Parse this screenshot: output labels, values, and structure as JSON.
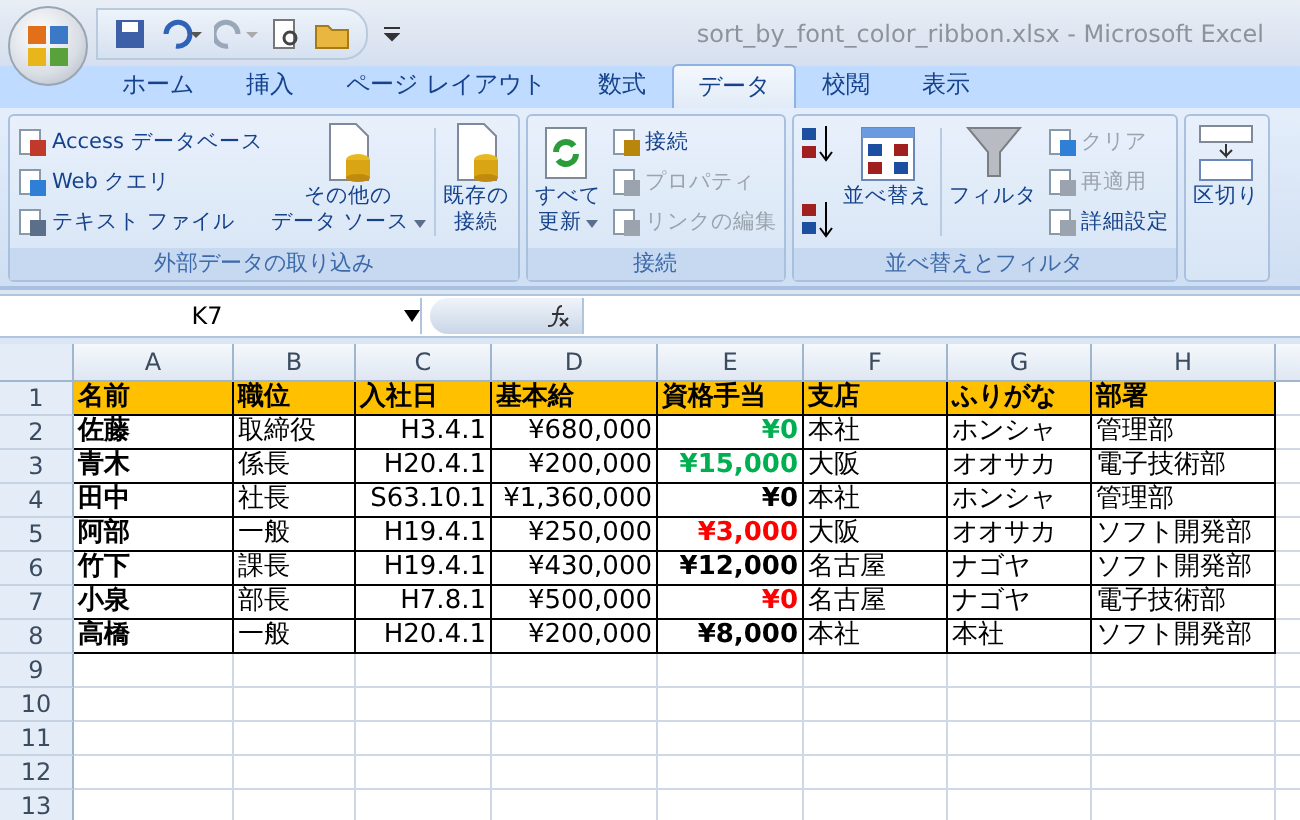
{
  "window": {
    "title": "sort_by_font_color_ribbon.xlsx - Microsoft Excel"
  },
  "tabs": [
    {
      "label": "ホーム",
      "selected": false
    },
    {
      "label": "挿入",
      "selected": false
    },
    {
      "label": "ページ レイアウト",
      "selected": false
    },
    {
      "label": "数式",
      "selected": false
    },
    {
      "label": "データ",
      "selected": true
    },
    {
      "label": "校閲",
      "selected": false
    },
    {
      "label": "表示",
      "selected": false
    }
  ],
  "ribbon_groups": [
    {
      "label": "外部データの取り込み",
      "columns": [
        {
          "kind": "stack",
          "items": [
            {
              "label": "Access データベース",
              "disabled": false
            },
            {
              "label": "Web クエリ",
              "disabled": false
            },
            {
              "label": "テキスト ファイル",
              "disabled": false
            }
          ]
        },
        {
          "kind": "large",
          "lines": [
            "その他の",
            "データ ソース"
          ],
          "dropdown": true
        },
        {
          "kind": "large",
          "lines": [
            "既存の",
            "接続"
          ]
        }
      ]
    },
    {
      "label": "接続",
      "columns": [
        {
          "kind": "large",
          "lines": [
            "すべて",
            "更新"
          ],
          "dropdown": true
        },
        {
          "kind": "stack",
          "items": [
            {
              "label": "接続",
              "disabled": false
            },
            {
              "label": "プロパティ",
              "disabled": true
            },
            {
              "label": "リンクの編集",
              "disabled": true
            }
          ]
        }
      ]
    },
    {
      "label": "並べ替えとフィルタ",
      "columns": [
        {
          "kind": "sort"
        },
        {
          "kind": "large",
          "lines": [
            "並べ替え"
          ]
        },
        {
          "kind": "large",
          "lines": [
            "フィルタ"
          ]
        },
        {
          "kind": "stack",
          "items": [
            {
              "label": "クリア",
              "disabled": true
            },
            {
              "label": "再適用",
              "disabled": true
            },
            {
              "label": "詳細設定",
              "disabled": false
            }
          ]
        }
      ]
    },
    {
      "columns": [
        {
          "kind": "large",
          "lines": [
            "区切り"
          ]
        }
      ]
    }
  ],
  "name_box": "K7",
  "sheet": {
    "columns": [
      "A",
      "B",
      "C",
      "D",
      "E",
      "F",
      "G",
      "H"
    ],
    "rows": [
      {
        "number": "1",
        "kind": "header",
        "cells": [
          {
            "text": "名前"
          },
          {
            "text": "職位"
          },
          {
            "text": "入社日"
          },
          {
            "text": "基本給"
          },
          {
            "text": "資格手当"
          },
          {
            "text": "支店"
          },
          {
            "text": "ふりがな"
          },
          {
            "text": "部署"
          }
        ]
      },
      {
        "number": "2",
        "kind": "data",
        "cells": [
          {
            "text": "佐藤"
          },
          {
            "text": "取締役"
          },
          {
            "text": "H3.4.1"
          },
          {
            "text": "¥680,000"
          },
          {
            "text": "¥0",
            "color": "#00b050"
          },
          {
            "text": "本社"
          },
          {
            "text": "ホンシャ"
          },
          {
            "text": "管理部"
          }
        ]
      },
      {
        "number": "3",
        "kind": "data",
        "cells": [
          {
            "text": "青木"
          },
          {
            "text": "係長"
          },
          {
            "text": "H20.4.1"
          },
          {
            "text": "¥200,000"
          },
          {
            "text": "¥15,000",
            "color": "#00b050"
          },
          {
            "text": "大阪"
          },
          {
            "text": "オオサカ"
          },
          {
            "text": "電子技術部"
          }
        ]
      },
      {
        "number": "4",
        "kind": "data",
        "cells": [
          {
            "text": "田中"
          },
          {
            "text": "社長"
          },
          {
            "text": "S63.10.1"
          },
          {
            "text": "¥1,360,000"
          },
          {
            "text": "¥0",
            "color": "#000000"
          },
          {
            "text": "本社"
          },
          {
            "text": "ホンシャ"
          },
          {
            "text": "管理部"
          }
        ]
      },
      {
        "number": "5",
        "kind": "data",
        "cells": [
          {
            "text": "阿部"
          },
          {
            "text": "一般"
          },
          {
            "text": "H19.4.1"
          },
          {
            "text": "¥250,000"
          },
          {
            "text": "¥3,000",
            "color": "#ff0000"
          },
          {
            "text": "大阪"
          },
          {
            "text": "オオサカ"
          },
          {
            "text": "ソフト開発部"
          }
        ]
      },
      {
        "number": "6",
        "kind": "data",
        "cells": [
          {
            "text": "竹下"
          },
          {
            "text": "課長"
          },
          {
            "text": "H19.4.1"
          },
          {
            "text": "¥430,000"
          },
          {
            "text": "¥12,000",
            "color": "#000000"
          },
          {
            "text": "名古屋"
          },
          {
            "text": "ナゴヤ"
          },
          {
            "text": "ソフト開発部"
          }
        ]
      },
      {
        "number": "7",
        "kind": "data",
        "cells": [
          {
            "text": "小泉"
          },
          {
            "text": "部長"
          },
          {
            "text": "H7.8.1"
          },
          {
            "text": "¥500,000"
          },
          {
            "text": "¥0",
            "color": "#ff0000"
          },
          {
            "text": "名古屋"
          },
          {
            "text": "ナゴヤ"
          },
          {
            "text": "電子技術部"
          }
        ]
      },
      {
        "number": "8",
        "kind": "data",
        "cells": [
          {
            "text": "高橋"
          },
          {
            "text": "一般"
          },
          {
            "text": "H20.4.1"
          },
          {
            "text": "¥200,000"
          },
          {
            "text": "¥8,000",
            "color": "#000000"
          },
          {
            "text": "本社"
          },
          {
            "text": "本社"
          },
          {
            "text": "ソフト開発部"
          }
        ]
      },
      {
        "number": "9",
        "kind": "empty",
        "cells": []
      },
      {
        "number": "10",
        "kind": "empty",
        "cells": []
      },
      {
        "number": "11",
        "kind": "empty",
        "cells": []
      },
      {
        "number": "12",
        "kind": "empty",
        "cells": []
      },
      {
        "number": "13",
        "kind": "empty",
        "cells": []
      }
    ]
  }
}
